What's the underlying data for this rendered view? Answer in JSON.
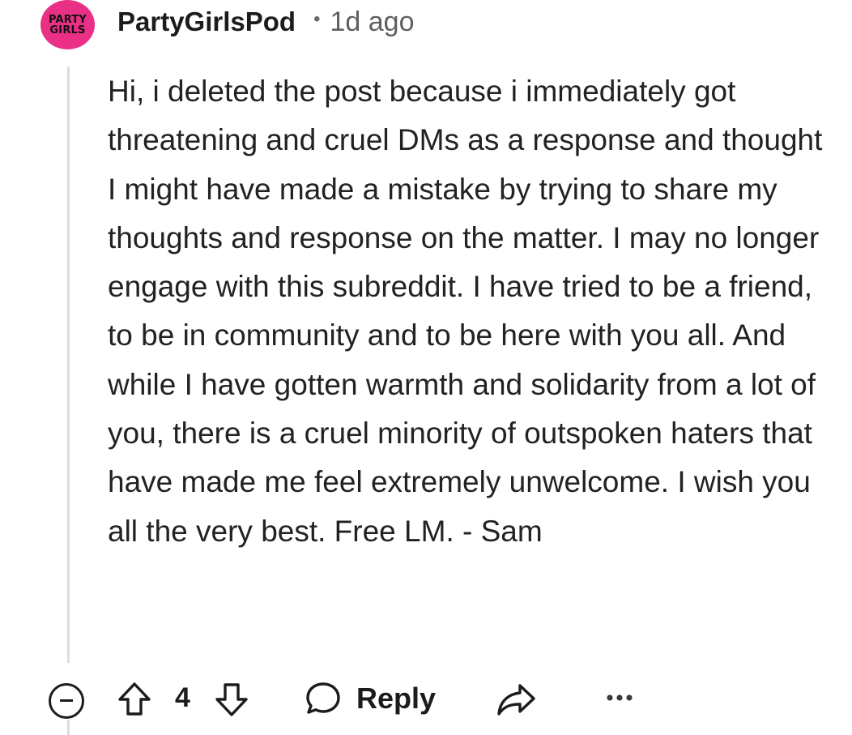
{
  "comment": {
    "avatar": {
      "line1": "PARTY",
      "line2": "GIRLS",
      "background": "#ea2f86"
    },
    "username": "PartyGirlsPod",
    "separator": "•",
    "time_ago": "1d ago",
    "body": "Hi, i deleted the post because i immediately got threatening and cruel DMs as a response and thought I might have made a mistake by trying to share my thoughts and response on the matter. I may no longer engage with this subreddit. I have tried to be a friend, to be in community and to be here with you all. And while I have gotten warmth and solidarity from a lot of you, there is a cruel minority of outspoken haters that have made me feel extremely unwelcome. I wish you all the very best. Free LM. - Sam"
  },
  "actions": {
    "collapse_icon": "collapse-minus-icon",
    "upvote_icon": "arrow-up-outline-icon",
    "vote_count": "4",
    "downvote_icon": "arrow-down-outline-icon",
    "reply_icon": "speech-bubble-icon",
    "reply_label": "Reply",
    "share_icon": "share-arrow-icon",
    "more_icon": "more-dots-icon"
  }
}
